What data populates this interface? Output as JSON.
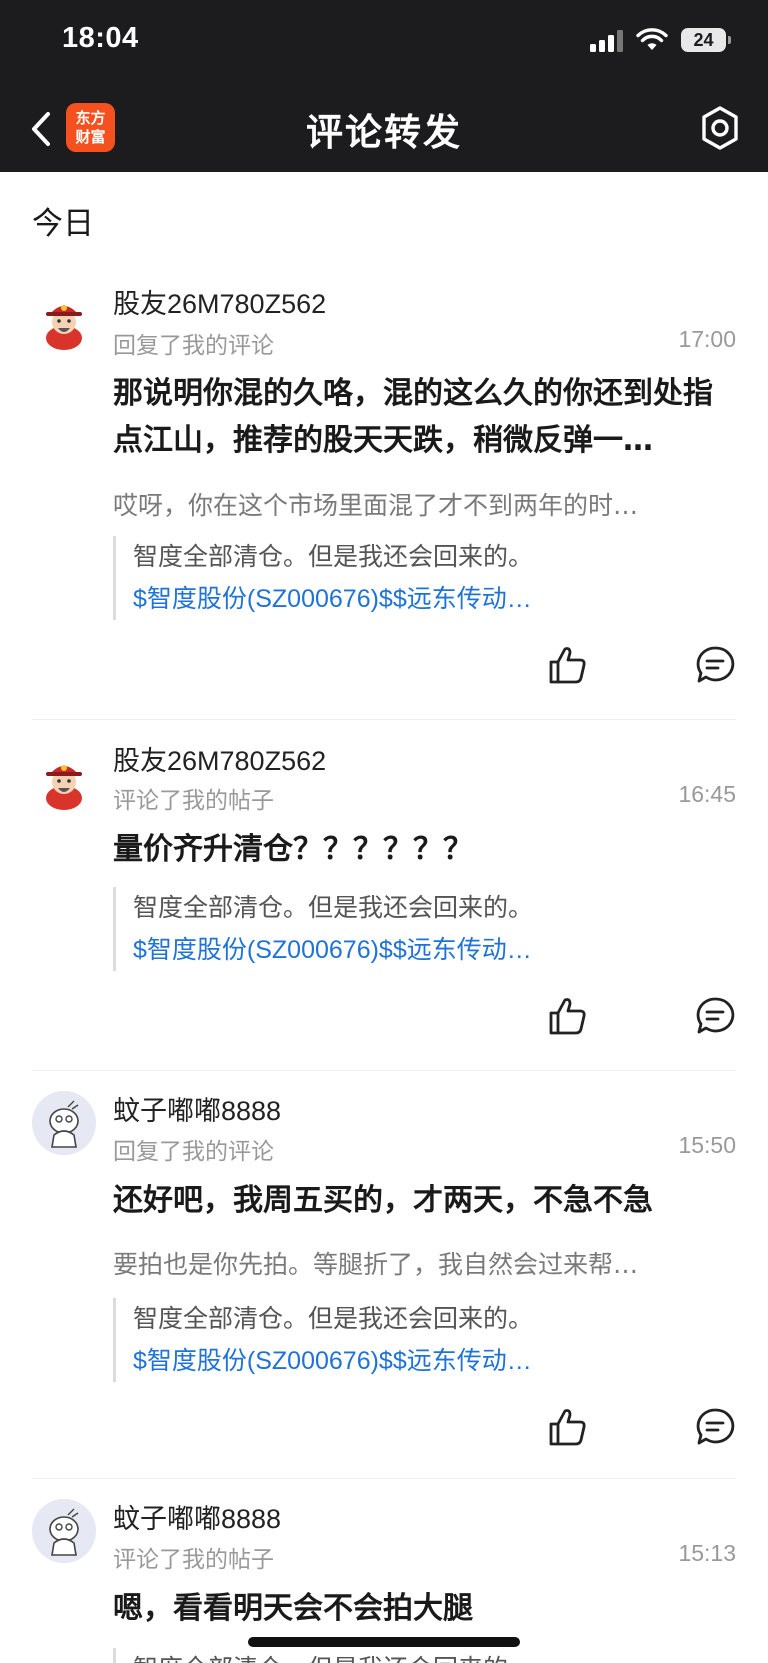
{
  "status_bar": {
    "time": "18:04",
    "battery": "24"
  },
  "nav": {
    "logo_line1": "东方",
    "logo_line2": "财富",
    "title": "评论转发"
  },
  "section": {
    "title": "今日"
  },
  "items": [
    {
      "user": "股友26M780Z562",
      "action": "回复了我的评论",
      "time": "17:00",
      "main": "那说明你混的久咯，混的这么久的你还到处指点江山，推荐的股天天跌，稍微反弹一…",
      "sub": "哎呀，你在这个市场里面混了才不到两年的时…",
      "quote_text": "智度全部清仓。但是我还会回来的。",
      "quote_link": "$智度股份(SZ000676)$$远东传动…"
    },
    {
      "user": "股友26M780Z562",
      "action": "评论了我的帖子",
      "time": "16:45",
      "main": "量价齐升清仓？？？？？？",
      "quote_text": "智度全部清仓。但是我还会回来的。",
      "quote_link": "$智度股份(SZ000676)$$远东传动…"
    },
    {
      "user": "蚊子嘟嘟8888",
      "action": "回复了我的评论",
      "time": "15:50",
      "main": "还好吧，我周五买的，才两天，不急不急",
      "sub": "要拍也是你先拍。等腿折了，我自然会过来帮…",
      "quote_text": "智度全部清仓。但是我还会回来的。",
      "quote_link": "$智度股份(SZ000676)$$远东传动…"
    },
    {
      "user": "蚊子嘟嘟8888",
      "action": "评论了我的帖子",
      "time": "15:13",
      "main": "嗯，看看明天会不会拍大腿",
      "quote_text": "智度全部清仓。但是我还会回来的。"
    }
  ],
  "colors": {
    "brand": "#f4511e",
    "link": "#1f73d8",
    "header": "#1c1c1e"
  },
  "icons": [
    "back-icon",
    "settings-icon",
    "like-icon",
    "comment-icon",
    "signal-icon",
    "wifi-icon",
    "battery-icon"
  ]
}
